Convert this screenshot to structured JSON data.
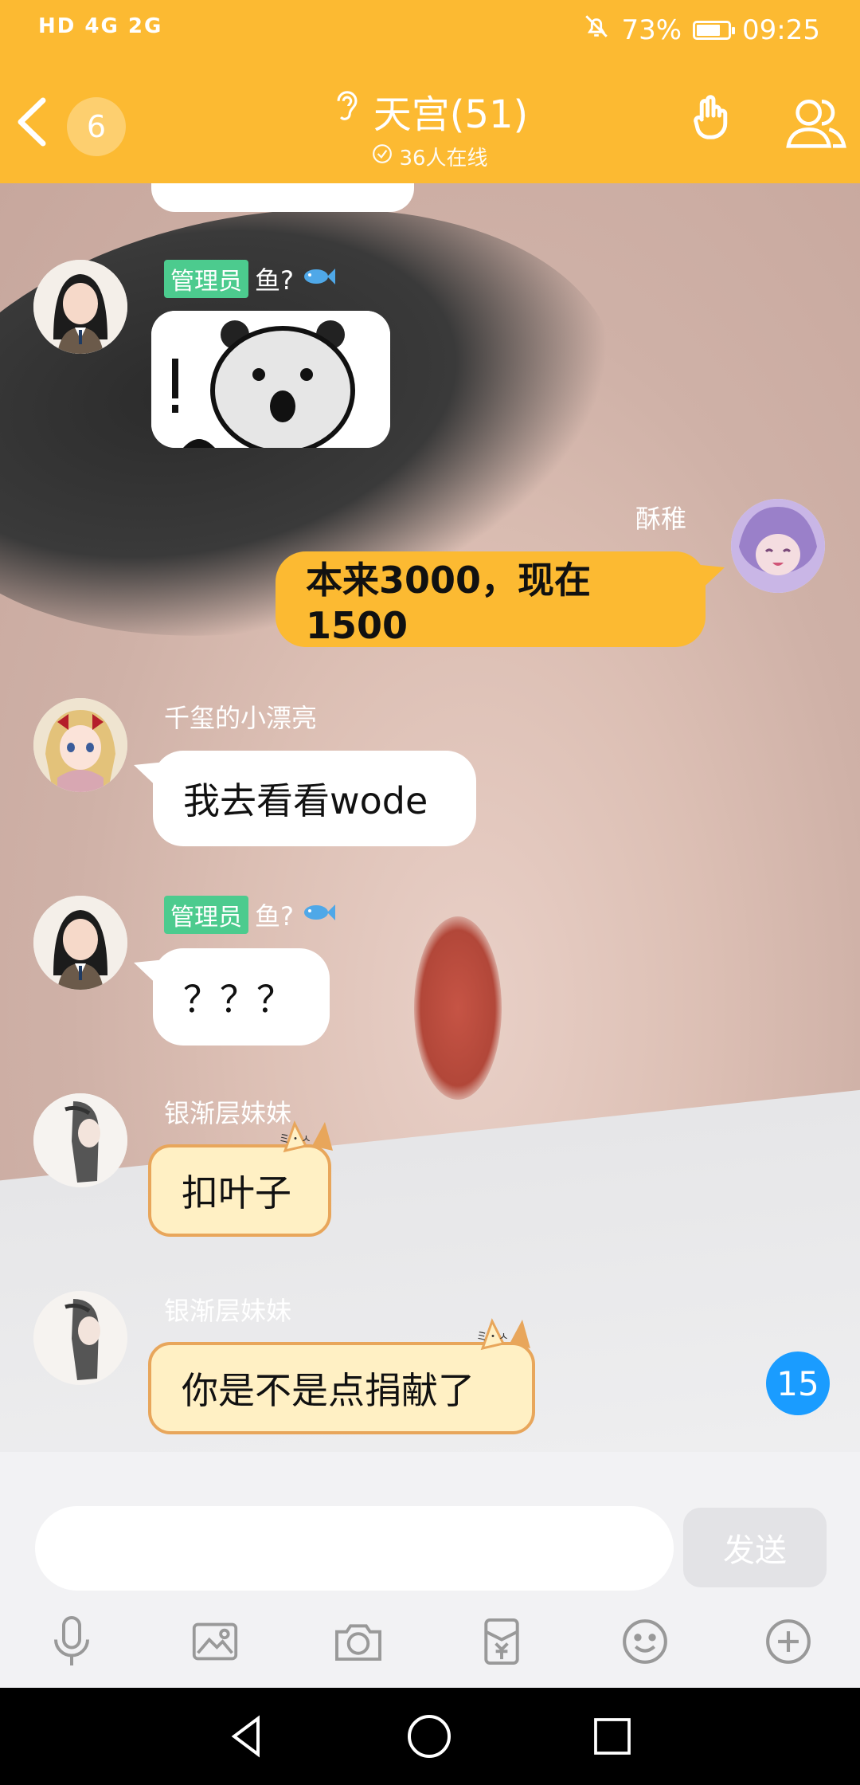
{
  "status_bar": {
    "left": "HD 4G 2G",
    "battery": "73%",
    "time": "09:25"
  },
  "header": {
    "unread_count": "6",
    "title": "天宫(51)",
    "subtitle": "36人在线"
  },
  "messages": [
    {
      "type": "sticker",
      "admin_tag": "管理员",
      "sender": "鱼?"
    },
    {
      "type": "text",
      "side": "right",
      "sender": "酥稚",
      "text": "本来3000，现在1500"
    },
    {
      "type": "text",
      "sender": "千玺的小漂亮",
      "text": "我去看看wode"
    },
    {
      "type": "text",
      "admin_tag": "管理员",
      "sender": "鱼?",
      "text": "？？？"
    },
    {
      "type": "text",
      "sender": "银渐层妹妹",
      "text": "扣叶子"
    },
    {
      "type": "text",
      "sender": "银渐层妹妹",
      "text": "你是不是点捐献了"
    }
  ],
  "new_messages_badge": "15",
  "input": {
    "send_label": "发送"
  },
  "toolbar_icons": [
    "microphone-icon",
    "image-icon",
    "camera-icon",
    "red-packet-icon",
    "emoji-icon",
    "plus-icon"
  ],
  "nav_icons": [
    "back-triangle-icon",
    "home-circle-icon",
    "recents-square-icon"
  ],
  "colors": {
    "header": "#FCBA32",
    "admin_tag": "#4CCB8E",
    "badge": "#1A9CFF"
  }
}
